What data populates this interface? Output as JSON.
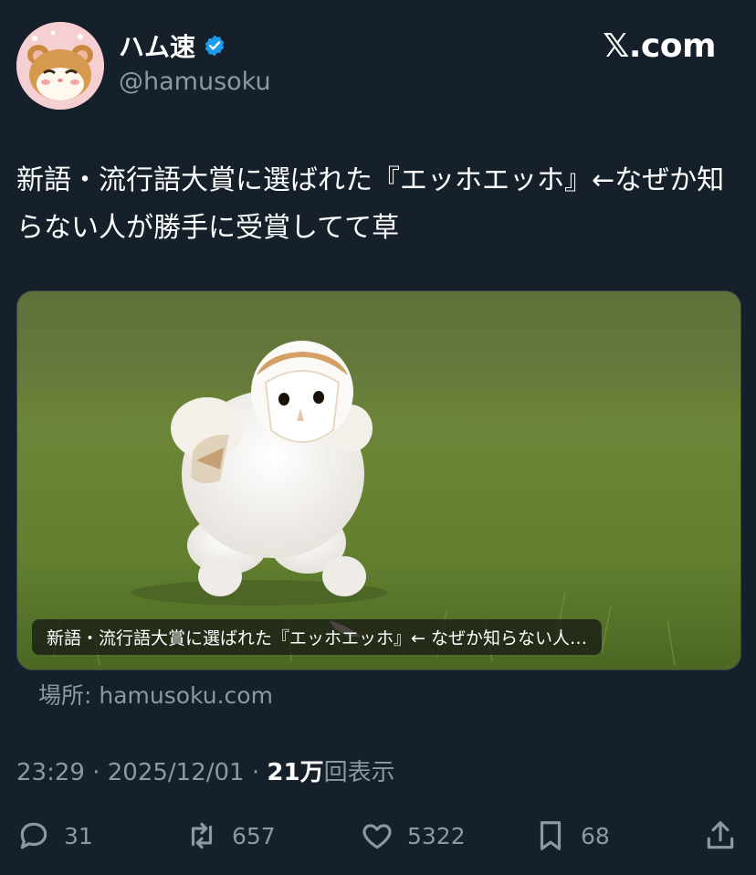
{
  "header": {
    "display_name": "ハム速",
    "handle": "@hamusoku",
    "brand": "𝕏.com",
    "verified_color": "#1d9bf0"
  },
  "tweet": {
    "text": "新語・流行語大賞に選ばれた『エッホエッホ』←なぜか知らない人が勝手に受賞してて草"
  },
  "card": {
    "caption": "新語・流行語大賞に選ばれた『エッホエッホ』← なぜか知らない人…",
    "source": "場所: hamusoku.com"
  },
  "meta": {
    "time": "23:29",
    "sep1": " · ",
    "date": "2025/12/01",
    "sep2": " · ",
    "views_count": "21万",
    "views_label": "回表示"
  },
  "actions": {
    "replies": "31",
    "retweets": "657",
    "likes": "5322",
    "bookmarks": "68"
  },
  "icons": [
    "avatar",
    "verified-badge-icon",
    "reply-icon",
    "retweet-icon",
    "like-icon",
    "bookmark-icon",
    "share-icon"
  ]
}
